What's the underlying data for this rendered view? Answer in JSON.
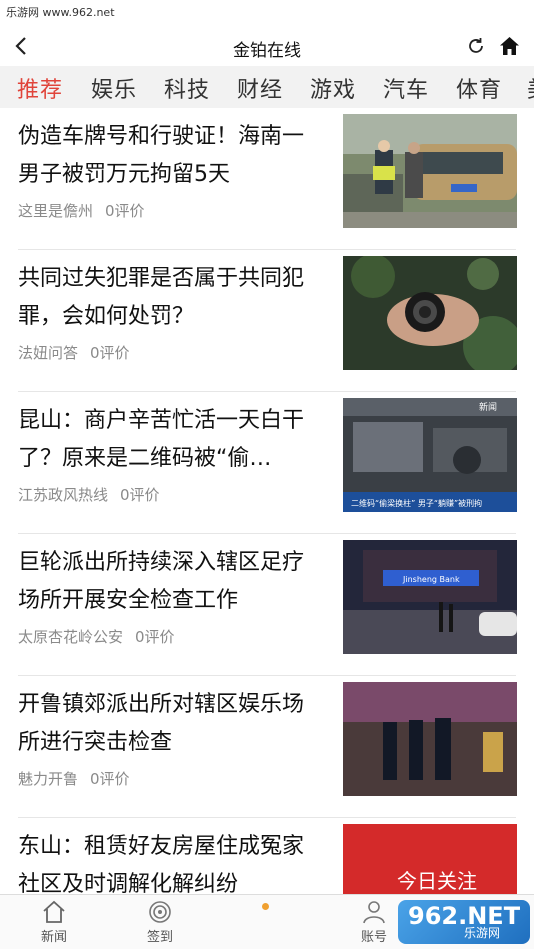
{
  "watermark": {
    "site": "乐游网 www.962.net",
    "badge_big": "962.NET",
    "badge_small": "乐游网"
  },
  "header": {
    "title": "金铂在线",
    "back_icon": "chevron-left-icon",
    "refresh_icon": "refresh-icon",
    "home_icon": "home-icon"
  },
  "tabs": [
    "推荐",
    "娱乐",
    "科技",
    "财经",
    "游戏",
    "汽车",
    "体育",
    "美"
  ],
  "active_tab": "推荐",
  "colors": {
    "accent": "#e0443a",
    "tab_bg": "#f2f2f2",
    "meta": "#8a8a8a",
    "dot": "#f0a030"
  },
  "news": [
    {
      "title": "伪造车牌号和行驶证！海南一男子被罚万元拘留5天",
      "source": "这里是儋州",
      "comments": "0评价"
    },
    {
      "title": "共同过失犯罪是否属于共同犯罪，会如何处罚？",
      "source": "法妞问答",
      "comments": "0评价"
    },
    {
      "title": "昆山：商户辛苦忙活一天白干了？原来是二维码被“偷…",
      "source": "江苏政风热线",
      "comments": "0评价"
    },
    {
      "title": "巨轮派出所持续深入辖区足疗场所开展安全检查工作",
      "source": "太原杏花岭公安",
      "comments": "0评价"
    },
    {
      "title": "开鲁镇郊派出所对辖区娱乐场所进行突击检查",
      "source": "魅力开鲁",
      "comments": "0评价"
    },
    {
      "title": "东山：租赁好友房屋住成冤家 社区及时调解化解纠纷",
      "source": "",
      "comments": ""
    }
  ],
  "thumb_texts": {
    "news2_banner": "二维码“偷梁换柱” 男子“躺赚”被刑拘",
    "news2_logo": "新闻",
    "news3_sign": "Jinsheng Bank",
    "news5_caption": "今日关注"
  },
  "bottom_nav": [
    {
      "label": "新闻",
      "icon": "house-icon"
    },
    {
      "label": "签到",
      "icon": "target-icon"
    },
    {
      "label": "",
      "icon": "dot-indicator"
    },
    {
      "label": "账号",
      "icon": "user-icon"
    }
  ]
}
